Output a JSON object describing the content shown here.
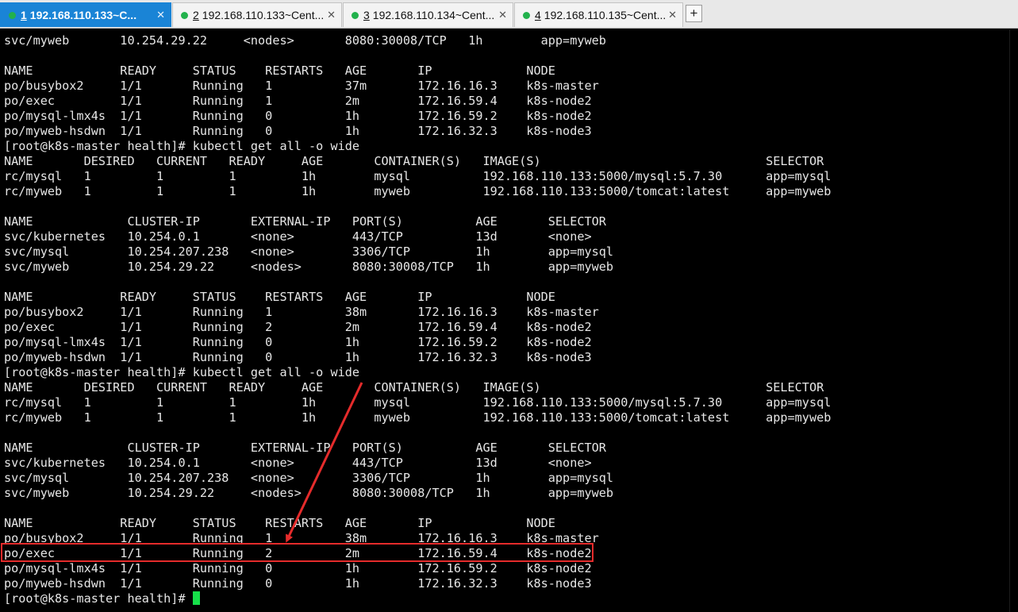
{
  "tabs": [
    {
      "num": "1",
      "label": "192.168.110.133~C...",
      "active": true
    },
    {
      "num": "2",
      "label": "192.168.110.133~Cent...",
      "active": false
    },
    {
      "num": "3",
      "label": "192.168.110.134~Cent...",
      "active": false
    },
    {
      "num": "4",
      "label": "192.168.110.135~Cent...",
      "active": false
    }
  ],
  "tab_close": "✕",
  "add_tab": "+",
  "terminal": {
    "prompt": "[root@k8s-master health]# ",
    "lines": [
      "svc/myweb       10.254.29.22     <nodes>       8080:30008/TCP   1h        app=myweb",
      "",
      "NAME            READY     STATUS    RESTARTS   AGE       IP             NODE",
      "po/busybox2     1/1       Running   1          37m       172.16.16.3    k8s-master",
      "po/exec         1/1       Running   1          2m        172.16.59.4    k8s-node2",
      "po/mysql-lmx4s  1/1       Running   0          1h        172.16.59.2    k8s-node2",
      "po/myweb-hsdwn  1/1       Running   0          1h        172.16.32.3    k8s-node3",
      "[root@k8s-master health]# kubectl get all -o wide",
      "NAME       DESIRED   CURRENT   READY     AGE       CONTAINER(S)   IMAGE(S)                               SELECTOR",
      "rc/mysql   1         1         1         1h        mysql          192.168.110.133:5000/mysql:5.7.30      app=mysql",
      "rc/myweb   1         1         1         1h        myweb          192.168.110.133:5000/tomcat:latest     app=myweb",
      "",
      "NAME             CLUSTER-IP       EXTERNAL-IP   PORT(S)          AGE       SELECTOR",
      "svc/kubernetes   10.254.0.1       <none>        443/TCP          13d       <none>",
      "svc/mysql        10.254.207.238   <none>        3306/TCP         1h        app=mysql",
      "svc/myweb        10.254.29.22     <nodes>       8080:30008/TCP   1h        app=myweb",
      "",
      "NAME            READY     STATUS    RESTARTS   AGE       IP             NODE",
      "po/busybox2     1/1       Running   1          38m       172.16.16.3    k8s-master",
      "po/exec         1/1       Running   2          2m        172.16.59.4    k8s-node2",
      "po/mysql-lmx4s  1/1       Running   0          1h        172.16.59.2    k8s-node2",
      "po/myweb-hsdwn  1/1       Running   0          1h        172.16.32.3    k8s-node3",
      "[root@k8s-master health]# kubectl get all -o wide",
      "NAME       DESIRED   CURRENT   READY     AGE       CONTAINER(S)   IMAGE(S)                               SELECTOR",
      "rc/mysql   1         1         1         1h        mysql          192.168.110.133:5000/mysql:5.7.30      app=mysql",
      "rc/myweb   1         1         1         1h        myweb          192.168.110.133:5000/tomcat:latest     app=myweb",
      "",
      "NAME             CLUSTER-IP       EXTERNAL-IP   PORT(S)          AGE       SELECTOR",
      "svc/kubernetes   10.254.0.1       <none>        443/TCP          13d       <none>",
      "svc/mysql        10.254.207.238   <none>        3306/TCP         1h        app=mysql",
      "svc/myweb        10.254.29.22     <nodes>       8080:30008/TCP   1h        app=myweb",
      "",
      "NAME            READY     STATUS    RESTARTS   AGE       IP             NODE",
      "po/busybox2     1/1       Running   1          38m       172.16.16.3    k8s-master",
      "po/exec         1/1       Running   2          2m        172.16.59.4    k8s-node2",
      "po/mysql-lmx4s  1/1       Running   0          1h        172.16.59.2    k8s-node2",
      "po/myweb-hsdwn  1/1       Running   0          1h        172.16.32.3    k8s-node3"
    ]
  },
  "colors": {
    "background": "#000000",
    "text": "#e6e6e6",
    "cursor": "#16e04a",
    "annotation": "#e52b2b",
    "active_tab": "#1a84d6",
    "status_dot": "#22b14c"
  }
}
